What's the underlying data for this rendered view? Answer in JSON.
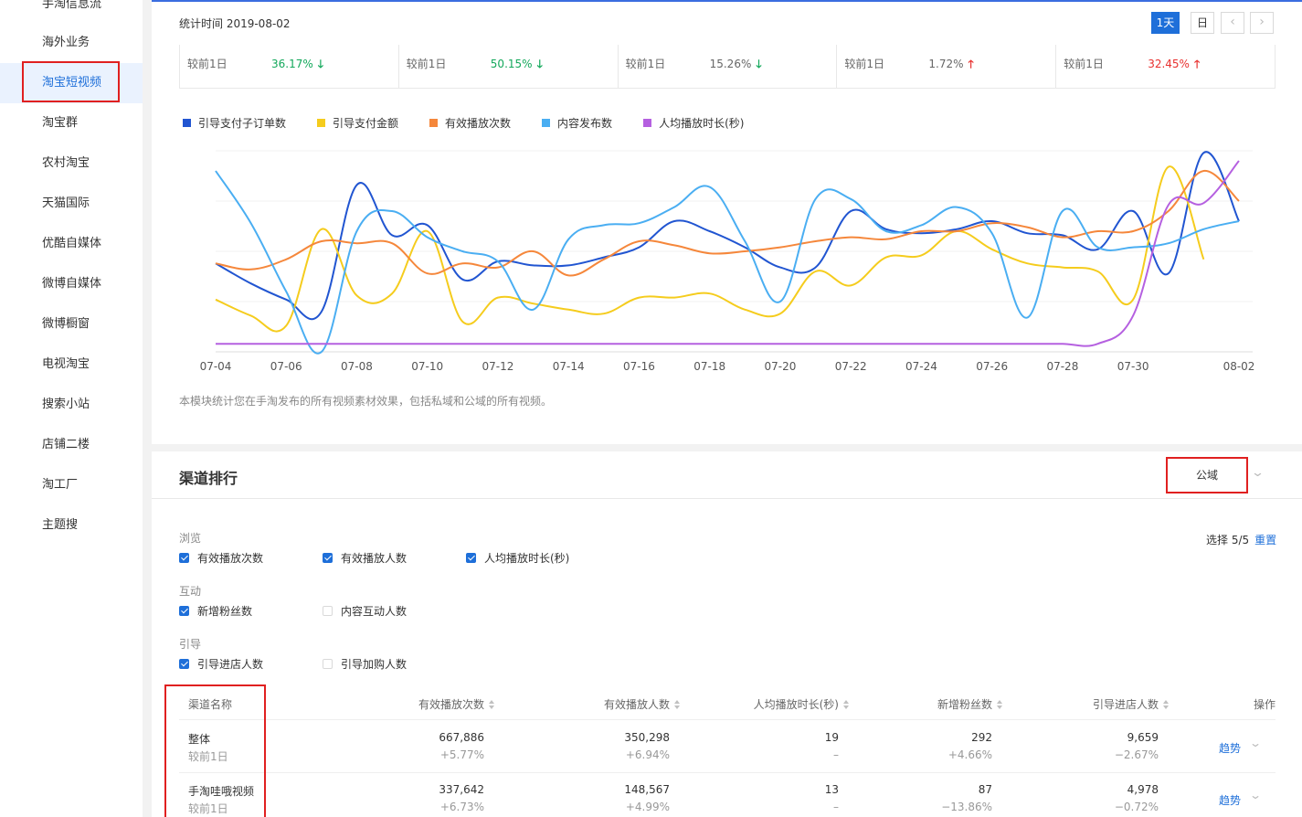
{
  "sidebar": {
    "items": [
      {
        "label": "手淘信息流"
      },
      {
        "label": "海外业务"
      },
      {
        "label": "淘宝短视频"
      },
      {
        "label": "淘宝群"
      },
      {
        "label": "农村淘宝"
      },
      {
        "label": "天猫国际"
      },
      {
        "label": "优酷自媒体"
      },
      {
        "label": "微博自媒体"
      },
      {
        "label": "微博橱窗"
      },
      {
        "label": "电视淘宝"
      },
      {
        "label": "搜索小站"
      },
      {
        "label": "店铺二楼"
      },
      {
        "label": "淘工厂"
      },
      {
        "label": "主题搜"
      }
    ],
    "active_index": 2
  },
  "header": {
    "stat_time": "统计时间 2019-08-02",
    "period_day": "1天",
    "period_calendar": "日",
    "prev_icon": "chevron-left-icon",
    "next_icon": "chevron-right-icon"
  },
  "stats": [
    {
      "label": "较前1日",
      "value": "36.17%",
      "direction": "down",
      "icon": "arrow-down-icon"
    },
    {
      "label": "较前1日",
      "value": "50.15%",
      "direction": "down",
      "icon": "arrow-down-icon"
    },
    {
      "label": "较前1日",
      "value": "15.26%",
      "direction": "down",
      "icon": "arrow-down-icon"
    },
    {
      "label": "较前1日",
      "value": "1.72%",
      "direction": "up",
      "icon": "arrow-up-icon"
    },
    {
      "label": "较前1日",
      "value": "32.45%",
      "direction": "up",
      "icon": "arrow-up-icon"
    }
  ],
  "colors": {
    "accent": "#1e6fd9",
    "down": "#13a85b",
    "up": "#e8312f",
    "highlight_box": "#e02020"
  },
  "chart_data": {
    "type": "line",
    "title": "",
    "xlabel": "",
    "ylabel": "",
    "grid": "horizontal",
    "legend_position": "top-left",
    "ylim": [
      0,
      100
    ],
    "x_ticks": [
      "07-04",
      "07-06",
      "07-08",
      "07-10",
      "07-12",
      "07-14",
      "07-16",
      "07-18",
      "07-20",
      "07-22",
      "07-24",
      "07-26",
      "07-28",
      "07-30",
      "08-02"
    ],
    "x": [
      "07-04",
      "07-05",
      "07-06",
      "07-07",
      "07-08",
      "07-09",
      "07-10",
      "07-11",
      "07-12",
      "07-13",
      "07-14",
      "07-15",
      "07-16",
      "07-17",
      "07-18",
      "07-19",
      "07-20",
      "07-21",
      "07-22",
      "07-23",
      "07-24",
      "07-25",
      "07-26",
      "07-27",
      "07-28",
      "07-29",
      "07-30",
      "07-31",
      "08-01",
      "08-02"
    ],
    "series": [
      {
        "name": "引导支付子订单数",
        "color": "#2155d1",
        "values": [
          44,
          34,
          26,
          20,
          83,
          58,
          63,
          36,
          45,
          43,
          43,
          47,
          52,
          65,
          60,
          52,
          42,
          42,
          70,
          61,
          59,
          61,
          65,
          59,
          58,
          51,
          70,
          39,
          99,
          65
        ]
      },
      {
        "name": "引导支付金额",
        "color": "#f5cc1d",
        "values": [
          26,
          18,
          13,
          61,
          28,
          29,
          60,
          15,
          27,
          24,
          21,
          19,
          27,
          27,
          29,
          21,
          19,
          40,
          33,
          47,
          48,
          60,
          51,
          44,
          42,
          40,
          26,
          92,
          46
        ]
      },
      {
        "name": "有效播放次数",
        "color": "#f5873b",
        "values": [
          44,
          41,
          46,
          55,
          54,
          54,
          39,
          44,
          42,
          50,
          38,
          46,
          55,
          53,
          49,
          50,
          52,
          55,
          57,
          56,
          60,
          60,
          64,
          62,
          57,
          60,
          60,
          70,
          90,
          75
        ]
      },
      {
        "name": "内容发布数",
        "color": "#4aaef2",
        "values": [
          90,
          64,
          30,
          0,
          60,
          70,
          57,
          50,
          45,
          21,
          56,
          63,
          64,
          72,
          82,
          55,
          25,
          76,
          76,
          60,
          63,
          72,
          59,
          17,
          70,
          52,
          52,
          54,
          61,
          65
        ]
      },
      {
        "name": "人均播放时长(秒)",
        "color": "#b560e0",
        "values": [
          4,
          4,
          4,
          4,
          4,
          4,
          4,
          4,
          4,
          4,
          4,
          4,
          4,
          4,
          4,
          4,
          4,
          4,
          4,
          4,
          4,
          4,
          4,
          4,
          4,
          4,
          18,
          73,
          74,
          95
        ]
      }
    ]
  },
  "chart_note": "本模块统计您在手淘发布的所有视频素材效果，包括私域和公域的所有视频。",
  "ranking": {
    "title": "渠道排行",
    "scope": "公域",
    "groups": [
      {
        "label": "浏览",
        "options": [
          {
            "label": "有效播放次数",
            "checked": true
          },
          {
            "label": "有效播放人数",
            "checked": true
          },
          {
            "label": "人均播放时长(秒)",
            "checked": true
          }
        ]
      },
      {
        "label": "互动",
        "options": [
          {
            "label": "新增粉丝数",
            "checked": true
          },
          {
            "label": "内容互动人数",
            "checked": false
          }
        ]
      },
      {
        "label": "引导",
        "options": [
          {
            "label": "引导进店人数",
            "checked": true
          },
          {
            "label": "引导加购人数",
            "checked": false
          }
        ]
      }
    ],
    "select_count": "选择 5/5",
    "reset": "重置",
    "columns": [
      "渠道名称",
      "有效播放次数",
      "有效播放人数",
      "人均播放时长(秒)",
      "新增粉丝数",
      "引导进店人数",
      "操作"
    ],
    "rows": [
      {
        "name": "整体",
        "compare": "较前1日",
        "plays": "667,886",
        "plays_d": "+5.77%",
        "viewers": "350,298",
        "viewers_d": "+6.94%",
        "avg": "19",
        "avg_d": "–",
        "fans": "292",
        "fans_d": "+4.66%",
        "visits": "9,659",
        "visits_d": "−2.67%",
        "action": "趋势"
      },
      {
        "name": "手淘哇哦视频",
        "compare": "较前1日",
        "plays": "337,642",
        "plays_d": "+6.73%",
        "viewers": "148,567",
        "viewers_d": "+4.99%",
        "avg": "13",
        "avg_d": "–",
        "fans": "87",
        "fans_d": "−13.86%",
        "visits": "4,978",
        "visits_d": "−0.72%",
        "action": "趋势"
      }
    ]
  }
}
